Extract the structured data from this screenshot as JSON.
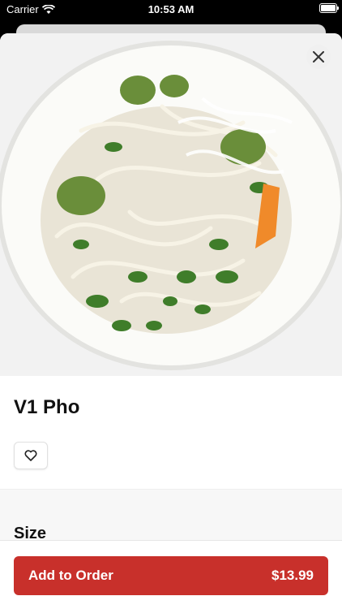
{
  "status_bar": {
    "carrier": "Carrier",
    "time": "10:53 AM"
  },
  "item": {
    "name": "V1 Pho",
    "image_alt": "bowl of pho"
  },
  "options": {
    "size_heading": "Size"
  },
  "order": {
    "add_label": "Add to Order",
    "price": "$13.99"
  },
  "colors": {
    "accent": "#c8302b"
  },
  "icons": {
    "close": "close-icon",
    "favorite": "heart-icon",
    "wifi": "wifi-icon",
    "battery": "battery-icon"
  }
}
